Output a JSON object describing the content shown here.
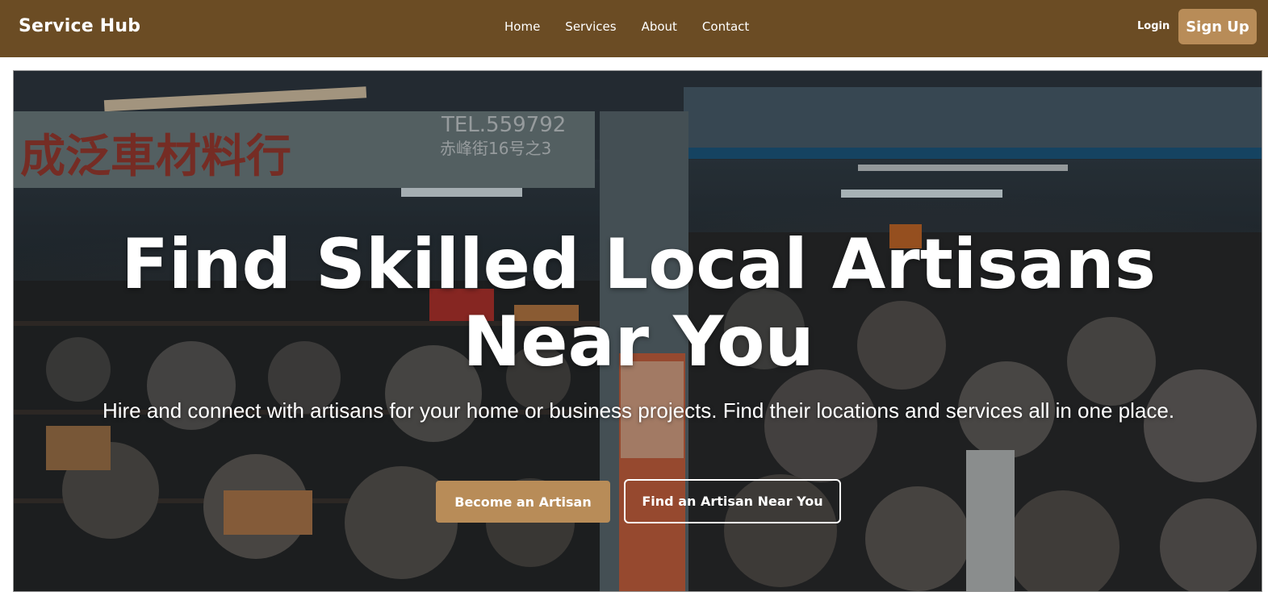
{
  "navbar": {
    "brand": "Service Hub",
    "links": [
      {
        "label": "Home"
      },
      {
        "label": "Services"
      },
      {
        "label": "About"
      },
      {
        "label": "Contact"
      }
    ],
    "login_label": "Login",
    "signup_label": "Sign Up"
  },
  "hero": {
    "title": "Find Skilled Local Artisans Near You",
    "subtitle": "Hire and connect with artisans for your home or business projects. Find their locations and services all in one place.",
    "primary_button": "Become an Artisan",
    "secondary_button": "Find an Artisan Near You",
    "sign_text": "成泛車材料行",
    "sign_phone": "TEL.559792",
    "sign_address": "赤峰街16号之3"
  },
  "colors": {
    "navbar_bg": "#6b4c24",
    "accent": "#b88c58",
    "text_light": "#ffffff"
  }
}
